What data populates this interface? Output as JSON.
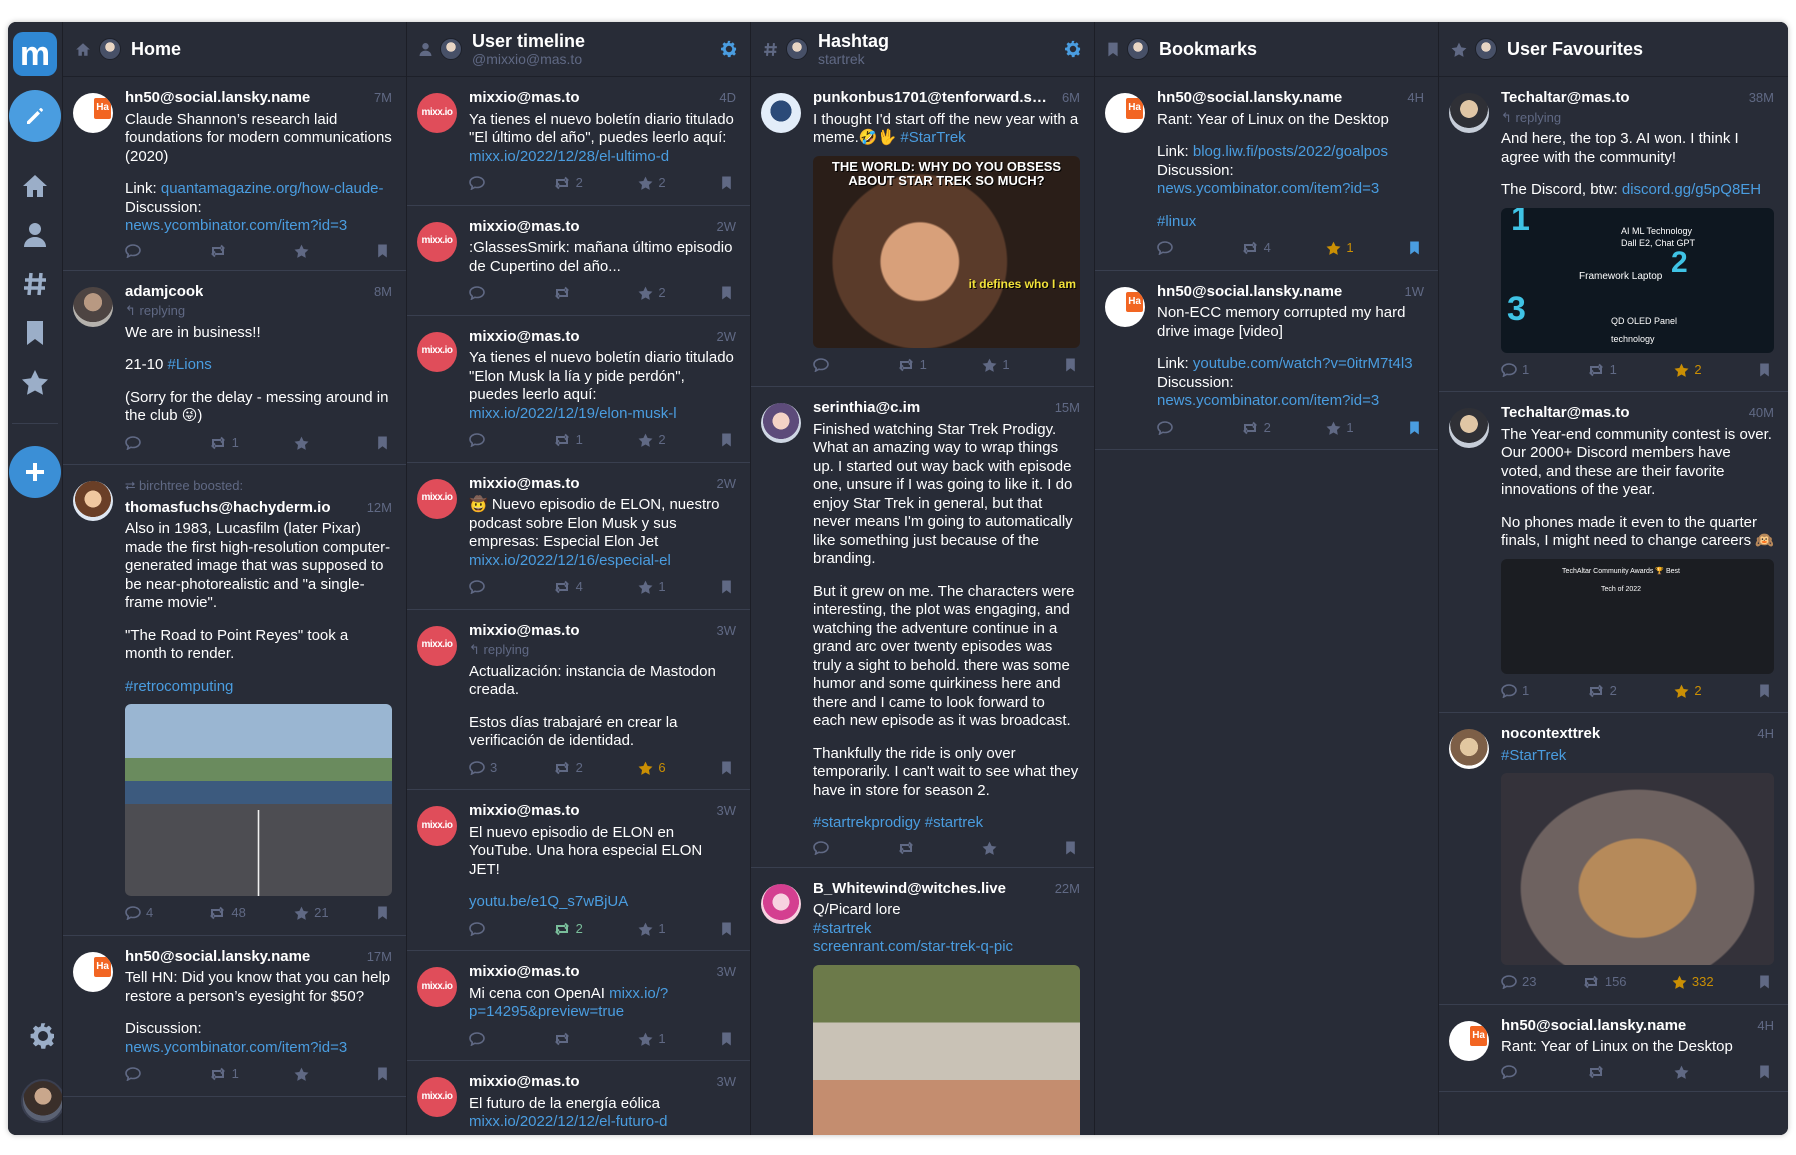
{
  "rail": {
    "logo": "m",
    "items": [
      {
        "icon": "home-icon"
      },
      {
        "icon": "user-icon"
      },
      {
        "icon": "hashtag-icon"
      },
      {
        "icon": "bookmark-icon"
      },
      {
        "icon": "star-icon"
      }
    ]
  },
  "columns": [
    {
      "title": "Home",
      "subtitle": "",
      "icon": "home-icon",
      "settings": false,
      "statuses": [
        {
          "avatar": "av-hn",
          "name": "hn50@social.lansky.name",
          "time": "7M",
          "paragraphs": [
            [
              "Claude Shannon’s research laid foundations for modern communications (2020)"
            ],
            [
              "Link: ",
              {
                "link": "quantamagazine.org/how-claude-"
              },
              "\nDiscussion: ",
              {
                "link": "news.ycombinator.com/item?id=3"
              }
            ]
          ],
          "counts": {
            "reply": "",
            "boost": "",
            "fav": ""
          }
        },
        {
          "avatar": "av-man",
          "name": "adamjcook",
          "time": "8M",
          "reply": "replying",
          "paragraphs": [
            [
              "We are in business!!"
            ],
            [
              "21-10 ",
              {
                "link": "#Lions"
              }
            ],
            [
              "(Sorry for the delay - messing around in the club 😜)"
            ]
          ],
          "counts": {
            "reply": "",
            "boost": "1",
            "fav": ""
          }
        },
        {
          "avatar": "av-cartoon",
          "name": "thomasfuchs@hachyderm.io",
          "time": "12M",
          "boost_by": "birchtree boosted:",
          "paragraphs": [
            [
              "Also in 1983, Lucasfilm (later Pixar) made the first high-resolution computer-generated image that was supposed to be near-photorealistic and \"a single-frame movie\"."
            ],
            [
              "\"The Road to Point Reyes\" took a month to render."
            ],
            [
              {
                "link": "#retrocomputing"
              }
            ]
          ],
          "media": "m-road",
          "counts": {
            "reply": "4",
            "boost": "48",
            "fav": "21"
          }
        },
        {
          "avatar": "av-hn",
          "name": "hn50@social.lansky.name",
          "time": "17M",
          "paragraphs": [
            [
              "Tell HN: Did you know that you can help restore a person’s eyesight for $50?"
            ],
            [
              "Discussion:\n",
              {
                "link": "news.ycombinator.com/item?id=3"
              }
            ]
          ],
          "counts": {
            "reply": "",
            "boost": "1",
            "fav": ""
          }
        }
      ]
    },
    {
      "title": "User timeline",
      "subtitle": "@mixxio@mas.to",
      "icon": "user-icon",
      "settings": true,
      "statuses": [
        {
          "avatar": "av-mixx",
          "name": "mixxio@mas.to",
          "time": "4D",
          "paragraphs": [
            [
              "Ya tienes el nuevo boletín diario titulado \"El último del año\", puedes leerlo aquí: ",
              {
                "link": "mixx.io/2022/12/28/el-ultimo-d"
              }
            ]
          ],
          "counts": {
            "reply": "",
            "boost": "2",
            "fav": "2"
          }
        },
        {
          "avatar": "av-mixx",
          "name": "mixxio@mas.to",
          "time": "2W",
          "paragraphs": [
            [
              ":GlassesSmirk: mañana último episodio de Cupertino del año..."
            ]
          ],
          "counts": {
            "reply": "",
            "boost": "",
            "fav": "2"
          }
        },
        {
          "avatar": "av-mixx",
          "name": "mixxio@mas.to",
          "time": "2W",
          "paragraphs": [
            [
              "Ya tienes el nuevo boletín diario titulado \"Elon Musk la lía y pide perdón\", puedes leerlo aquí: ",
              {
                "link": "mixx.io/2022/12/19/elon-musk-l"
              }
            ]
          ],
          "counts": {
            "reply": "",
            "boost": "1",
            "fav": "2"
          }
        },
        {
          "avatar": "av-mixx",
          "name": "mixxio@mas.to",
          "time": "2W",
          "paragraphs": [
            [
              "🤠 Nuevo episodio de ELON, nuestro podcast sobre Elon Musk y sus empresas: Especial Elon Jet ",
              {
                "link": "mixx.io/2022/12/16/especial-el"
              }
            ]
          ],
          "counts": {
            "reply": "",
            "boost": "4",
            "fav": "1"
          }
        },
        {
          "avatar": "av-mixx",
          "name": "mixxio@mas.to",
          "time": "3W",
          "reply": "replying",
          "paragraphs": [
            [
              "Actualización: instancia de Mastodon creada."
            ],
            [
              "Estos días trabajaré en crear la verificación de identidad."
            ]
          ],
          "counts": {
            "reply": "3",
            "boost": "2",
            "fav": "6"
          },
          "fav_on": true
        },
        {
          "avatar": "av-mixx",
          "name": "mixxio@mas.to",
          "time": "3W",
          "paragraphs": [
            [
              "El nuevo episodio de ELON en YouTube. Una hora especial ELON JET!"
            ],
            [
              {
                "link": "youtu.be/e1Q_s7wBjUA"
              }
            ]
          ],
          "counts": {
            "reply": "",
            "boost": "2",
            "fav": "1"
          },
          "boost_on": true
        },
        {
          "avatar": "av-mixx",
          "name": "mixxio@mas.to",
          "time": "3W",
          "paragraphs": [
            [
              "Mi cena con OpenAI ",
              {
                "link": "mixx.io/?p=14295&preview=true"
              }
            ]
          ],
          "counts": {
            "reply": "",
            "boost": "",
            "fav": "1"
          }
        },
        {
          "avatar": "av-mixx",
          "name": "mixxio@mas.to",
          "time": "3W",
          "paragraphs": [
            [
              "El futuro de la energía eólica ",
              {
                "link": "mixx.io/2022/12/12/el-futuro-d"
              }
            ]
          ],
          "counts": {
            "reply": "",
            "boost": "",
            "fav": ""
          }
        }
      ]
    },
    {
      "title": "Hashtag",
      "subtitle": "startrek",
      "icon": "hashtag-icon",
      "settings": true,
      "statuses": [
        {
          "avatar": "av-bot",
          "name": "punkonbus1701@tenforward.social",
          "time": "6M",
          "paragraphs": [
            [
              "I thought I'd start off the new year with a meme.🤣🖖 ",
              {
                "link": "#StarTrek"
              }
            ]
          ],
          "media": "m-meme",
          "meme_top": "THE WORLD: WHY DO YOU OBSESS ABOUT STAR TREK SO MUCH?",
          "meme_bottom": "it defines who I am",
          "counts": {
            "reply": "",
            "boost": "1",
            "fav": "1"
          }
        },
        {
          "avatar": "av-anime",
          "name": "serinthia@c.im",
          "time": "15M",
          "paragraphs": [
            [
              "Finished watching Star Trek Prodigy. What an amazing way to wrap things up. I started out way back with episode one, unsure if I was going to like it. I do enjoy Star Trek in general, but that never means I'm going to automatically like something just because of the branding."
            ],
            [
              "But it grew on me. The characters were interesting, the plot was engaging, and watching the adventure continue in a grand arc over twenty episodes was truly a sight to behold. there was some humor and some quirkiness here and there and I came to look forward to each new episode as it was broadcast."
            ],
            [
              "Thankfully the ride is only over temporarily. I can't wait to see what they have in store for season 2."
            ],
            [
              {
                "link": "#startrekprodigy"
              },
              " ",
              {
                "link": "#startrek"
              }
            ]
          ],
          "counts": {
            "reply": "",
            "boost": "",
            "fav": ""
          }
        },
        {
          "avatar": "av-pink",
          "name": "B_Whitewind@witches.live",
          "time": "22M",
          "paragraphs": [
            [
              "Q/Picard lore\n",
              {
                "link": "#startrek"
              },
              "\n",
              {
                "link": "screenrant.com/star-trek-q-pic"
              }
            ]
          ],
          "media": "m-picard",
          "counts": {
            "reply": "",
            "boost": "",
            "fav": ""
          }
        }
      ]
    },
    {
      "title": "Bookmarks",
      "subtitle": "",
      "icon": "bookmark-icon",
      "settings": false,
      "statuses": [
        {
          "avatar": "av-hn",
          "name": "hn50@social.lansky.name",
          "time": "4H",
          "paragraphs": [
            [
              "Rant: Year of Linux on the Desktop"
            ],
            [
              "Link: ",
              {
                "link": "blog.liw.fi/posts/2022/goalpos"
              },
              "\nDiscussion: ",
              {
                "link": "news.ycombinator.com/item?id=3"
              }
            ],
            [
              {
                "link": "#linux"
              }
            ]
          ],
          "counts": {
            "reply": "",
            "boost": "4",
            "fav": "1"
          },
          "fav_on": true,
          "bm_on": true
        },
        {
          "avatar": "av-hn",
          "name": "hn50@social.lansky.name",
          "time": "1W",
          "paragraphs": [
            [
              "Non-ECC memory corrupted my hard drive image [video]"
            ],
            [
              "Link: ",
              {
                "link": "youtube.com/watch?v=0itrM7t4l3"
              },
              "\nDiscussion: ",
              {
                "link": "news.ycombinator.com/item?id=3"
              }
            ]
          ],
          "counts": {
            "reply": "",
            "boost": "2",
            "fav": "1"
          },
          "bm_on": true
        }
      ]
    },
    {
      "title": "User Favourites",
      "subtitle": "",
      "icon": "star-icon",
      "settings": false,
      "statuses": [
        {
          "avatar": "av-tech",
          "name": "Techaltar@mas.to",
          "time": "38M",
          "reply": "replying",
          "paragraphs": [
            [
              "And here, the top 3. AI won. I think I agree with the community!"
            ],
            [
              "The Discord, btw: ",
              {
                "link": "discord.gg/g5pQ8EH"
              }
            ]
          ],
          "media": "m-ai",
          "counts": {
            "reply": "1",
            "boost": "1",
            "fav": "2"
          },
          "fav_on": true
        },
        {
          "avatar": "av-tech",
          "name": "Techaltar@mas.to",
          "time": "40M",
          "paragraphs": [
            [
              "The Year-end community contest is over. Our 2000+ Discord members have voted, and these are their favorite innovations of the year."
            ],
            [
              "No phones made it even to the quarter finals, I might need to change careers 🙉"
            ]
          ],
          "media": "m-bracket",
          "counts": {
            "reply": "1",
            "boost": "2",
            "fav": "2"
          },
          "fav_on": true
        },
        {
          "avatar": "av-noctx",
          "name": "nocontexttrek",
          "time": "4H",
          "paragraphs": [
            [
              {
                "link": "#StarTrek"
              }
            ]
          ],
          "media": "m-bridge",
          "counts": {
            "reply": "23",
            "boost": "156",
            "fav": "332"
          },
          "fav_on": true
        },
        {
          "avatar": "av-hn",
          "name": "hn50@social.lansky.name",
          "time": "4H",
          "paragraphs": [
            [
              "Rant: Year of Linux on the Desktop"
            ]
          ],
          "counts": {
            "reply": "",
            "boost": "",
            "fav": ""
          }
        }
      ]
    }
  ],
  "ai_card": {
    "line1": "AI ML Technology",
    "line2": "Dall E2, Chat GPT",
    "line3": "Framework Laptop",
    "line4": "QD OLED Panel technology",
    "num1": "1",
    "num2": "2",
    "num3": "3"
  },
  "bracket_title": "TechAltar Community Awards 🏆 Best Tech of 2022",
  "colors": {
    "accent": "#4a9de0",
    "favourite": "#ca8f04",
    "boost": "#79bd9a"
  }
}
